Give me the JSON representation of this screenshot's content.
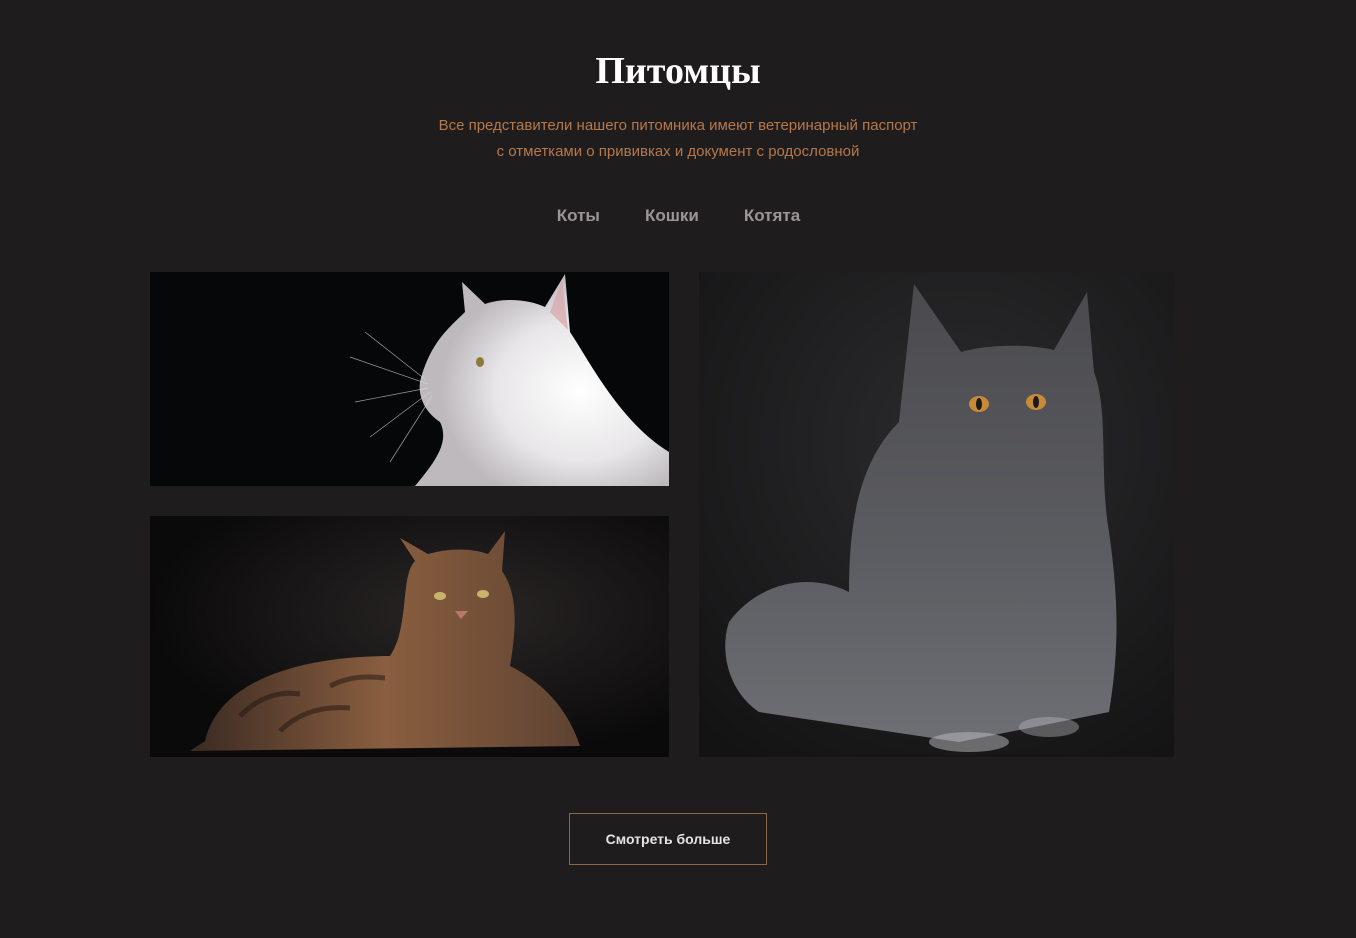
{
  "section": {
    "title": "Питомцы",
    "subtitle_line1": "Все представители нашего питомника имеют ветеринарный паспорт",
    "subtitle_line2": "с отметками о прививках и документ с родословной"
  },
  "tabs": [
    {
      "label": "Коты"
    },
    {
      "label": "Кошки"
    },
    {
      "label": "Котята"
    }
  ],
  "gallery": [
    {
      "icon": "white-cat-photo"
    },
    {
      "icon": "tabby-cat-photo"
    },
    {
      "icon": "gray-cat-photo"
    }
  ],
  "more_button": {
    "label": "Смотреть больше"
  },
  "colors": {
    "background": "#1f1c1d",
    "accent": "#b6784a",
    "button_border": "#8a6546",
    "tab_text": "#9a9697"
  }
}
